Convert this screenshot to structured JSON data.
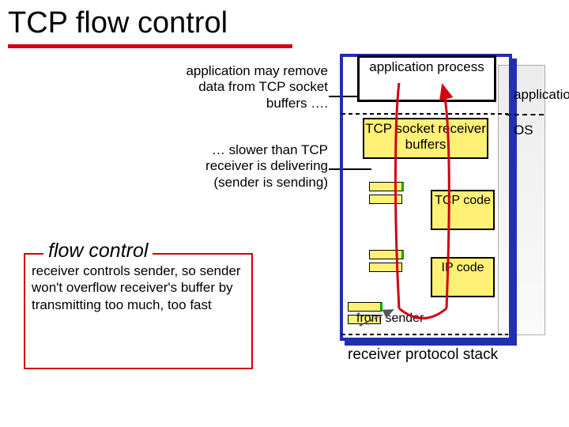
{
  "title": "TCP flow control",
  "annotations": {
    "a1": "application may remove data from TCP socket buffers ….",
    "a2": "… slower than TCP receiver is delivering (sender is sending)"
  },
  "flow_control": {
    "legend": "flow control",
    "text": "receiver controls sender, so sender won't overflow receiver's buffer by transmitting too much, too fast"
  },
  "stack": {
    "app_process": "application process",
    "socket_buffers": "TCP socket receiver buffers",
    "tcp_code": "TCP code",
    "ip_code": "IP code",
    "from_sender": "from sender",
    "caption": "receiver protocol stack"
  },
  "side_labels": {
    "application": "application",
    "os": "OS"
  }
}
